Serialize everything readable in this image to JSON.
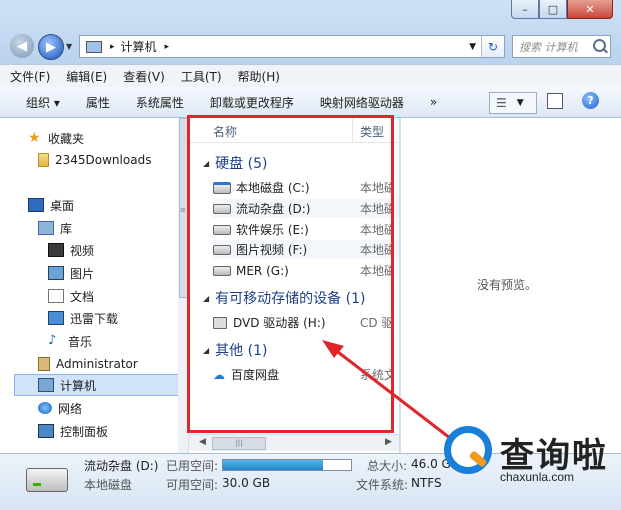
{
  "window": {
    "caption": {
      "minimize": "–",
      "maximize": "□",
      "close": "✕"
    }
  },
  "address": {
    "separator": "▸",
    "location": "计算机",
    "trail": "▸",
    "search_placeholder": "搜索 计算机"
  },
  "menubar": [
    "文件(F)",
    "编辑(E)",
    "查看(V)",
    "工具(T)",
    "帮助(H)"
  ],
  "toolbar": {
    "organize": "组织 ▾",
    "items": [
      "属性",
      "系统属性",
      "卸载或更改程序",
      "映射网络驱动器",
      "»"
    ],
    "help": "?"
  },
  "navpane": {
    "favorites": "收藏夹",
    "fav_item": "2345Downloads",
    "desktop": "桌面",
    "library": "库",
    "lib_items": [
      "视频",
      "图片",
      "文档",
      "迅雷下载",
      "音乐"
    ],
    "admin": "Administrator",
    "computer": "计算机",
    "network": "网络",
    "control_panel": "控制面板"
  },
  "content": {
    "col_name": "名称",
    "col_type": "类型",
    "groups": [
      {
        "label": "硬盘 (5)",
        "items": [
          {
            "name": "本地磁盘 (C:)",
            "type": "本地磁盘"
          },
          {
            "name": "流动杂盘 (D:)",
            "type": "本地磁盘"
          },
          {
            "name": "软件娱乐 (E:)",
            "type": "本地磁盘"
          },
          {
            "name": "图片视频 (F:)",
            "type": "本地磁盘"
          },
          {
            "name": "MER (G:)",
            "type": "本地磁盘"
          }
        ]
      },
      {
        "label": "有可移动存储的设备 (1)",
        "items": [
          {
            "name": "DVD 驱动器 (H:)",
            "type": "CD 驱动器"
          }
        ]
      },
      {
        "label": "其他 (1)",
        "items": [
          {
            "name": "百度网盘",
            "type": "系统文件夹"
          }
        ]
      }
    ]
  },
  "preview": {
    "message": "没有预览。"
  },
  "status": {
    "drive_name": "流动杂盘 (D:)",
    "drive_type": "本地磁盘",
    "used_label": "已用空间:",
    "used_fraction": 0.78,
    "free_label": "可用空间:",
    "free_value": "30.0 GB",
    "total_label": "总大小:",
    "total_value": "46.0 G",
    "fs_label": "文件系统:",
    "fs_value": "NTFS"
  },
  "watermark": {
    "cn": "查询啦",
    "en": "chaxunla.com"
  },
  "colors": {
    "annotation": "#e0262a",
    "accent": "#1a7fd8"
  }
}
